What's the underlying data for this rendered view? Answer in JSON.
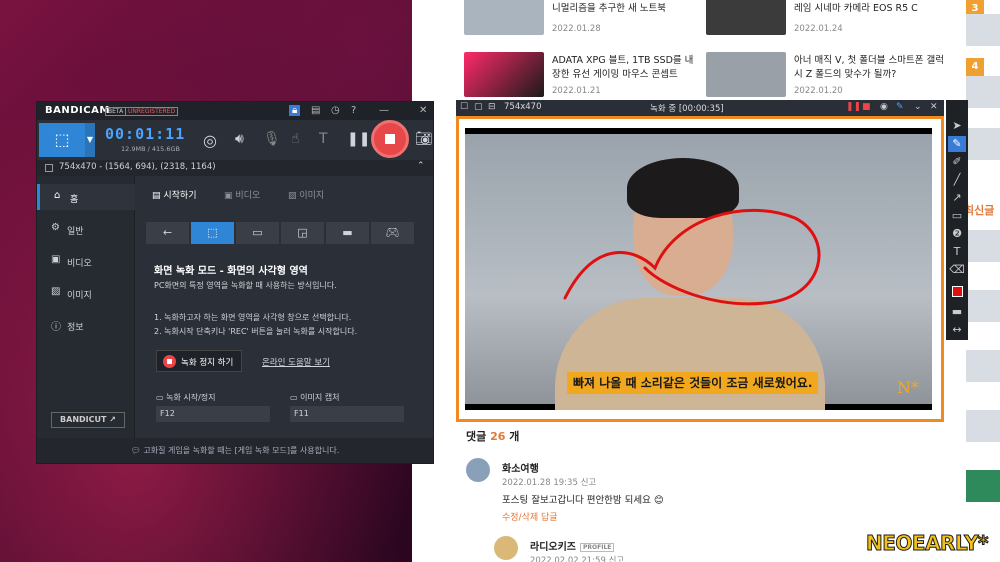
{
  "bandicam": {
    "logo": "BANDICAM",
    "tag_beta": "BETA",
    "tag_unregistered": "UNREGISTERED",
    "timer": "00:01:11",
    "storage": "12.9MB / 415.6GB",
    "region": "754x470 - (1564, 694), (2318, 1164)",
    "sidebar": [
      {
        "icon": "home-icon",
        "label": "홈"
      },
      {
        "icon": "gear-icon",
        "label": "일반"
      },
      {
        "icon": "video-icon",
        "label": "비디오"
      },
      {
        "icon": "image-icon",
        "label": "이미지"
      },
      {
        "icon": "info-icon",
        "label": "정보"
      }
    ],
    "bandicut_label": "BANDICUT ↗",
    "tabs": [
      "시작하기",
      "비디오",
      "이미지"
    ],
    "mode_heading": "화면 녹화 모드 - 화면의 사각형 영역",
    "mode_desc": "PC화면의 특정 영역을 녹화할 때 사용하는 방식입니다.",
    "step1": "1. 녹화하고자 하는 화면 영역을 사각형 창으로 선택합니다.",
    "step2": "2. 녹화시작 단축키나 'REC' 버튼을 눌러 녹화를 시작합니다.",
    "stop_label": "녹화 정지 하기",
    "help_link": "온라인 도움말 보기",
    "hotkey_rec_label": "녹화 시작/정지",
    "hotkey_rec_value": "F12",
    "hotkey_cap_label": "이미지 캡처",
    "hotkey_cap_value": "F11",
    "footer": "고화질 게임을 녹화할 때는 [게임 녹화 모드]를 사용합니다."
  },
  "recorder": {
    "size": "754x470",
    "status": "녹화 중 [00:00:35]",
    "subtitle": "빠져 나올 때 소리같은 것들이 조금 새로웠어요.",
    "logo": "N*"
  },
  "news": [
    {
      "title": "니멀리즘을 추구한 새 노트북",
      "date": "2022.01.28",
      "color": "#aab4bf"
    },
    {
      "title": "레임 시네마 카메라 EOS R5 C",
      "date": "2022.01.24",
      "color": "#3b3b3b"
    },
    {
      "title": "ADATA XPG 블트, 1TB SSD를 내장한 유선 게이밍 마우스 콘셉트",
      "date": "2022.01.21",
      "color": "#7a1a3a"
    },
    {
      "title": "아너 매직 V, 첫 폴더블 스마트폰 갤럭시 Z 폴드의 맞수가 될까?",
      "date": "2022.01.20",
      "color": "#9aa0a8"
    }
  ],
  "ranks": [
    "3",
    "4"
  ],
  "side_label": "최신글",
  "comments": {
    "label": "댓글",
    "count": "26",
    "suffix": "개",
    "items": [
      {
        "name": "화소여행",
        "meta": "2022.01.28 19:35 신고",
        "text": "포스팅 잘보고갑니다 편안한밤 되세요 😊",
        "actions": "수정/삭제 답글"
      },
      {
        "name": "라디오키즈",
        "badge": "PROFILE",
        "meta": "2022.02.02 21:59 신고"
      }
    ]
  },
  "watermark": "NEOEARLY*"
}
